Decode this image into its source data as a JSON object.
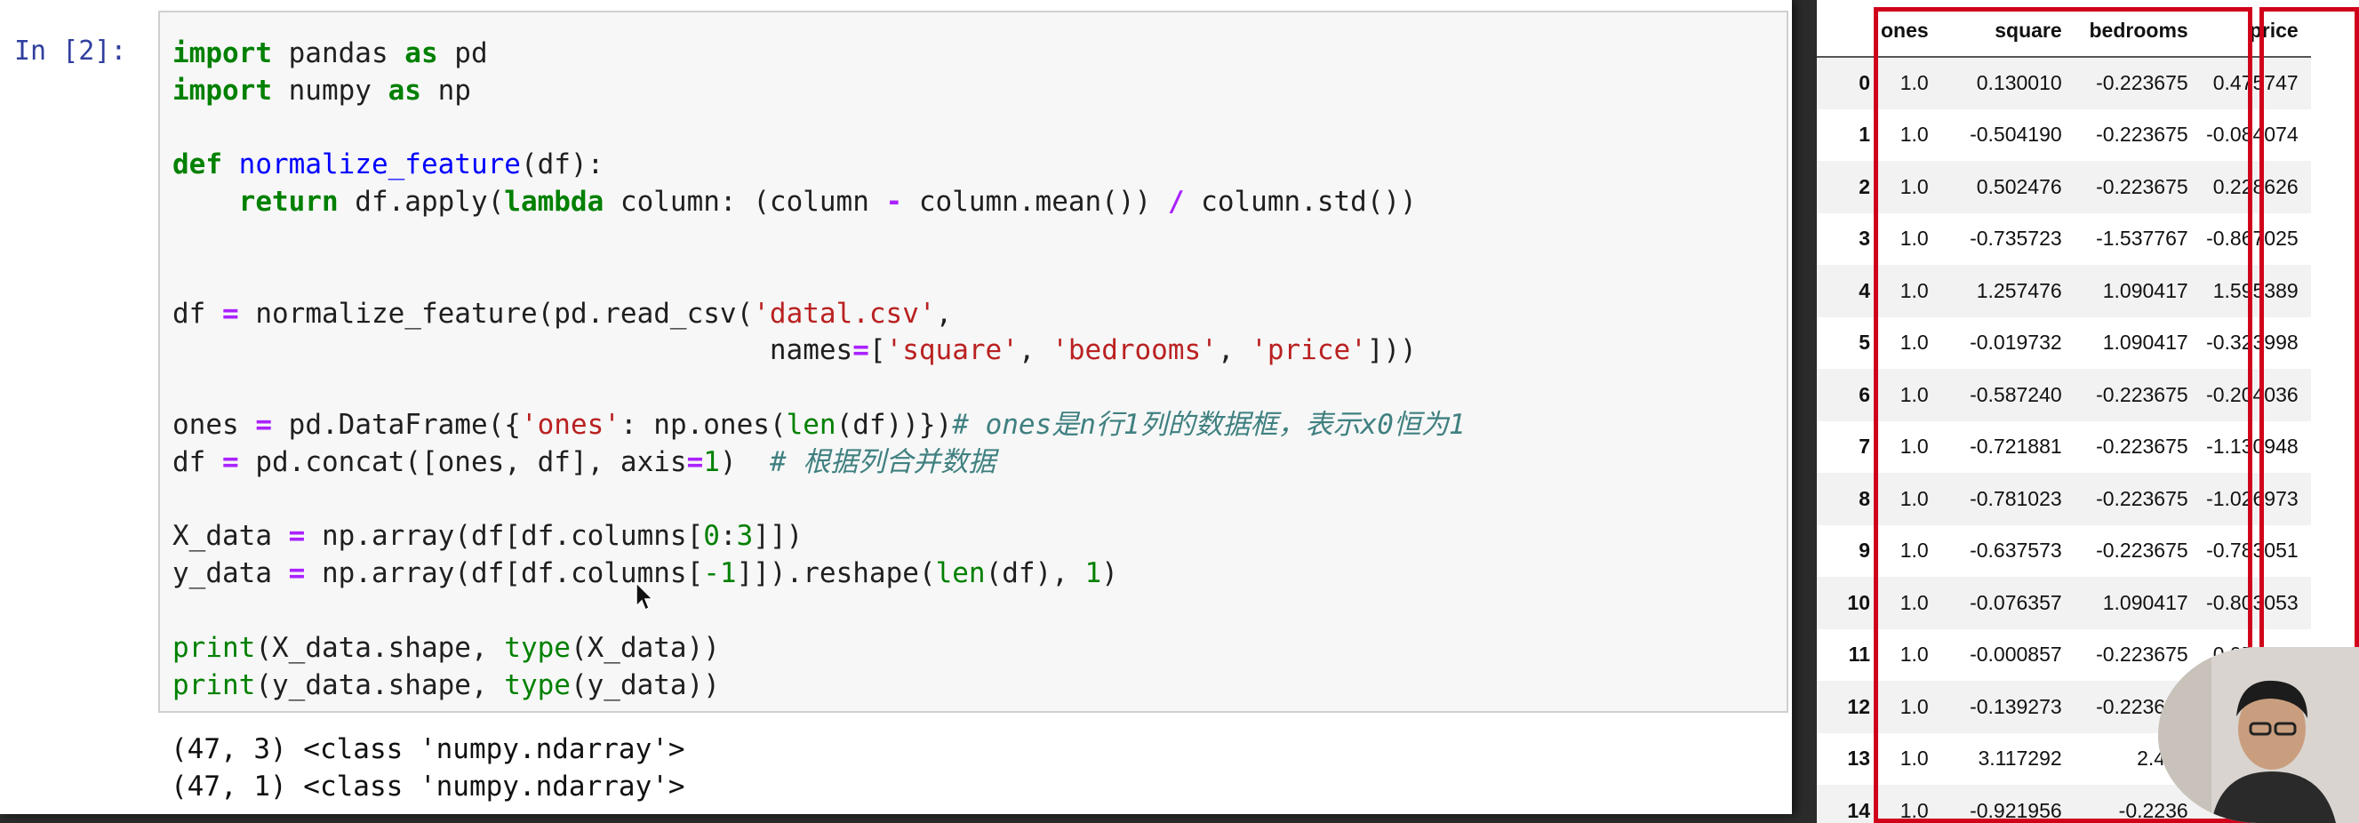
{
  "notebook": {
    "prompt": "In [2]:",
    "code_lines": [
      [
        {
          "t": "import",
          "c": "kw"
        },
        {
          "t": " pandas "
        },
        {
          "t": "as",
          "c": "kw"
        },
        {
          "t": " pd"
        }
      ],
      [
        {
          "t": "import",
          "c": "kw"
        },
        {
          "t": " numpy "
        },
        {
          "t": "as",
          "c": "kw"
        },
        {
          "t": " np"
        }
      ],
      [],
      [
        {
          "t": "def",
          "c": "kw"
        },
        {
          "t": " "
        },
        {
          "t": "normalize_feature",
          "c": "fn"
        },
        {
          "t": "(df):"
        }
      ],
      [
        {
          "t": "    "
        },
        {
          "t": "return",
          "c": "kw"
        },
        {
          "t": " df.apply("
        },
        {
          "t": "lambda",
          "c": "kw"
        },
        {
          "t": " column: (column "
        },
        {
          "t": "-",
          "c": "op"
        },
        {
          "t": " column.mean()) "
        },
        {
          "t": "/",
          "c": "op"
        },
        {
          "t": " column.std())"
        }
      ],
      [],
      [],
      [
        {
          "t": "df "
        },
        {
          "t": "=",
          "c": "op"
        },
        {
          "t": " normalize_feature(pd.read_csv("
        },
        {
          "t": "'datal.csv'",
          "c": "str"
        },
        {
          "t": ","
        }
      ],
      [
        {
          "t": "                                    names"
        },
        {
          "t": "=",
          "c": "op"
        },
        {
          "t": "["
        },
        {
          "t": "'square'",
          "c": "str"
        },
        {
          "t": ", "
        },
        {
          "t": "'bedrooms'",
          "c": "str"
        },
        {
          "t": ", "
        },
        {
          "t": "'price'",
          "c": "str"
        },
        {
          "t": "]))"
        }
      ],
      [],
      [
        {
          "t": "ones "
        },
        {
          "t": "=",
          "c": "op"
        },
        {
          "t": " pd.DataFrame({"
        },
        {
          "t": "'ones'",
          "c": "str"
        },
        {
          "t": ": np.ones("
        },
        {
          "t": "len",
          "c": "bi"
        },
        {
          "t": "(df))})"
        },
        {
          "t": "# ones是n行1列的数据框，表示x0恒为1",
          "c": "cm"
        }
      ],
      [
        {
          "t": "df "
        },
        {
          "t": "=",
          "c": "op"
        },
        {
          "t": " pd.concat([ones, df], axis"
        },
        {
          "t": "=",
          "c": "op"
        },
        {
          "t": "1",
          "c": "num"
        },
        {
          "t": ")  "
        },
        {
          "t": "# 根据列合并数据",
          "c": "cm"
        }
      ],
      [],
      [
        {
          "t": "X_data "
        },
        {
          "t": "=",
          "c": "op"
        },
        {
          "t": " np.array(df[df.columns["
        },
        {
          "t": "0",
          "c": "num"
        },
        {
          "t": ":"
        },
        {
          "t": "3",
          "c": "num"
        },
        {
          "t": "]])"
        }
      ],
      [
        {
          "t": "y_data "
        },
        {
          "t": "=",
          "c": "op"
        },
        {
          "t": " np.array(df[df.columns["
        },
        {
          "t": "-1",
          "c": "num"
        },
        {
          "t": "]]).reshape("
        },
        {
          "t": "len",
          "c": "bi"
        },
        {
          "t": "(df), "
        },
        {
          "t": "1",
          "c": "num"
        },
        {
          "t": ")"
        }
      ],
      [],
      [
        {
          "t": "print",
          "c": "bi"
        },
        {
          "t": "(X_data.shape, "
        },
        {
          "t": "type",
          "c": "bi"
        },
        {
          "t": "(X_data))"
        }
      ],
      [
        {
          "t": "print",
          "c": "bi"
        },
        {
          "t": "(y_data.shape, "
        },
        {
          "t": "type",
          "c": "bi"
        },
        {
          "t": "(y_data))"
        }
      ]
    ],
    "output_lines": [
      "(47, 3) <class 'numpy.ndarray'>",
      "(47, 1) <class 'numpy.ndarray'>"
    ]
  },
  "dataframe": {
    "columns": [
      "ones",
      "square",
      "bedrooms",
      "price"
    ],
    "rows": [
      [
        "0",
        "1.0",
        "0.130010",
        "-0.223675",
        "0.475747"
      ],
      [
        "1",
        "1.0",
        "-0.504190",
        "-0.223675",
        "-0.084074"
      ],
      [
        "2",
        "1.0",
        "0.502476",
        "-0.223675",
        "0.228626"
      ],
      [
        "3",
        "1.0",
        "-0.735723",
        "-1.537767",
        "-0.867025"
      ],
      [
        "4",
        "1.0",
        "1.257476",
        "1.090417",
        "1.595389"
      ],
      [
        "5",
        "1.0",
        "-0.019732",
        "1.090417",
        "-0.323998"
      ],
      [
        "6",
        "1.0",
        "-0.587240",
        "-0.223675",
        "-0.204036"
      ],
      [
        "7",
        "1.0",
        "-0.721881",
        "-0.223675",
        "-1.130948"
      ],
      [
        "8",
        "1.0",
        "-0.781023",
        "-0.223675",
        "-1.026973"
      ],
      [
        "9",
        "1.0",
        "-0.637573",
        "-0.223675",
        "-0.783051"
      ],
      [
        "10",
        "1.0",
        "-0.076357",
        "1.090417",
        "-0.803053"
      ],
      [
        "11",
        "1.0",
        "-0.000857",
        "-0.223675",
        "0.052682"
      ],
      [
        "12",
        "1.0",
        "-0.139273",
        "-0.223675",
        ""
      ],
      [
        "13",
        "1.0",
        "3.117292",
        "2.404",
        ""
      ],
      [
        "14",
        "1.0",
        "-0.921956",
        "-0.2236",
        ""
      ]
    ]
  },
  "colors": {
    "highlight": "#d0021b",
    "keyword": "#008000",
    "string": "#ba2121",
    "comment": "#408080"
  },
  "icons": {
    "cursor": "mouse-pointer-icon"
  }
}
